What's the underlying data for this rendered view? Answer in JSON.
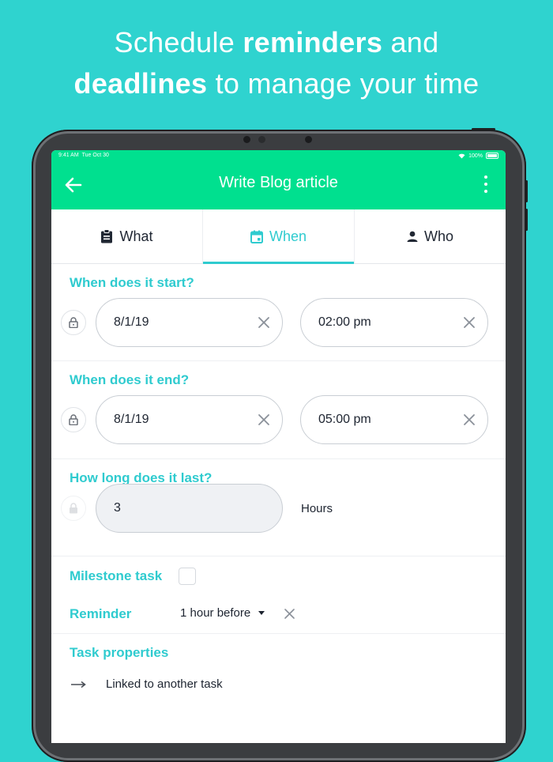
{
  "headline": {
    "part1": "Schedule ",
    "bold1": "reminders",
    "part2": " and",
    "bold2": "deadlines",
    "part3": " to manage your time"
  },
  "status_bar": {
    "time": "9:41 AM",
    "date": "Tue Oct 30",
    "battery": "100%"
  },
  "appbar": {
    "title": "Write Blog article",
    "color": "#00e08f"
  },
  "tabs": [
    {
      "label": "What",
      "icon": "clipboard-icon"
    },
    {
      "label": "When",
      "icon": "calendar-icon",
      "active": true
    },
    {
      "label": "Who",
      "icon": "person-icon"
    }
  ],
  "start": {
    "label": "When does it start?",
    "date": "8/1/19",
    "time": "02:00 pm"
  },
  "end": {
    "label": "When does it end?",
    "date": "8/1/19",
    "time": "05:00 pm"
  },
  "duration": {
    "label": "How long does it last?",
    "value": "3",
    "unit": "Hours"
  },
  "milestone": {
    "label": "Milestone task",
    "checked": false
  },
  "reminder": {
    "label": "Reminder",
    "value": "1 hour before"
  },
  "properties": {
    "label": "Task properties",
    "items": [
      {
        "label": "Linked to another task",
        "icon": "arrow-right-icon"
      }
    ]
  },
  "colors": {
    "accent": "#2fcbcf",
    "background": "#2fd3cf",
    "header": "#00e08f"
  }
}
